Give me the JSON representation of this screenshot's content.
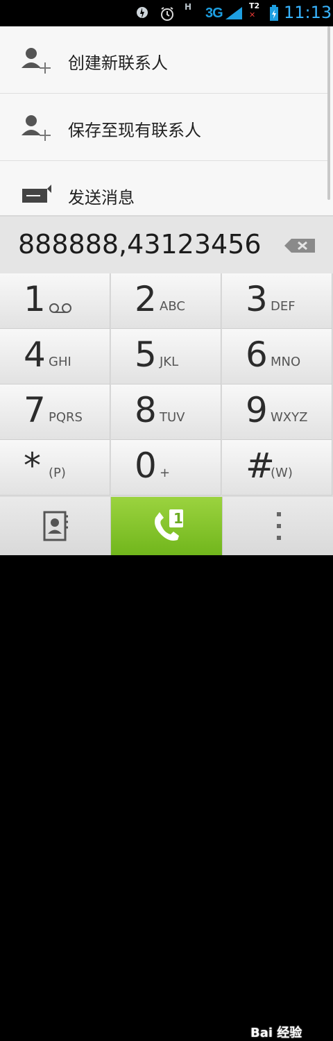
{
  "status_bar": {
    "network_indicator": "H",
    "signal_type": "3G",
    "sim_label": "T2",
    "time": "11:13"
  },
  "options": [
    {
      "label": "创建新联系人",
      "icon": "add-contact-icon"
    },
    {
      "label": "保存至现有联系人",
      "icon": "add-contact-icon"
    },
    {
      "label": "发送消息",
      "icon": "message-icon"
    }
  ],
  "dialer": {
    "number": "888888,43123456"
  },
  "keypad": {
    "keys": [
      {
        "digit": "1",
        "letters": ""
      },
      {
        "digit": "2",
        "letters": "ABC"
      },
      {
        "digit": "3",
        "letters": "DEF"
      },
      {
        "digit": "4",
        "letters": "GHI"
      },
      {
        "digit": "5",
        "letters": "JKL"
      },
      {
        "digit": "6",
        "letters": "MNO"
      },
      {
        "digit": "7",
        "letters": "PQRS"
      },
      {
        "digit": "8",
        "letters": "TUV"
      },
      {
        "digit": "9",
        "letters": "WXYZ"
      },
      {
        "digit": "*",
        "letters": "(P)"
      },
      {
        "digit": "0",
        "letters": "+"
      },
      {
        "digit": "#",
        "letters": "(W)"
      }
    ]
  },
  "call_button": {
    "sim_number": "1"
  },
  "watermark": "Bai 经验"
}
